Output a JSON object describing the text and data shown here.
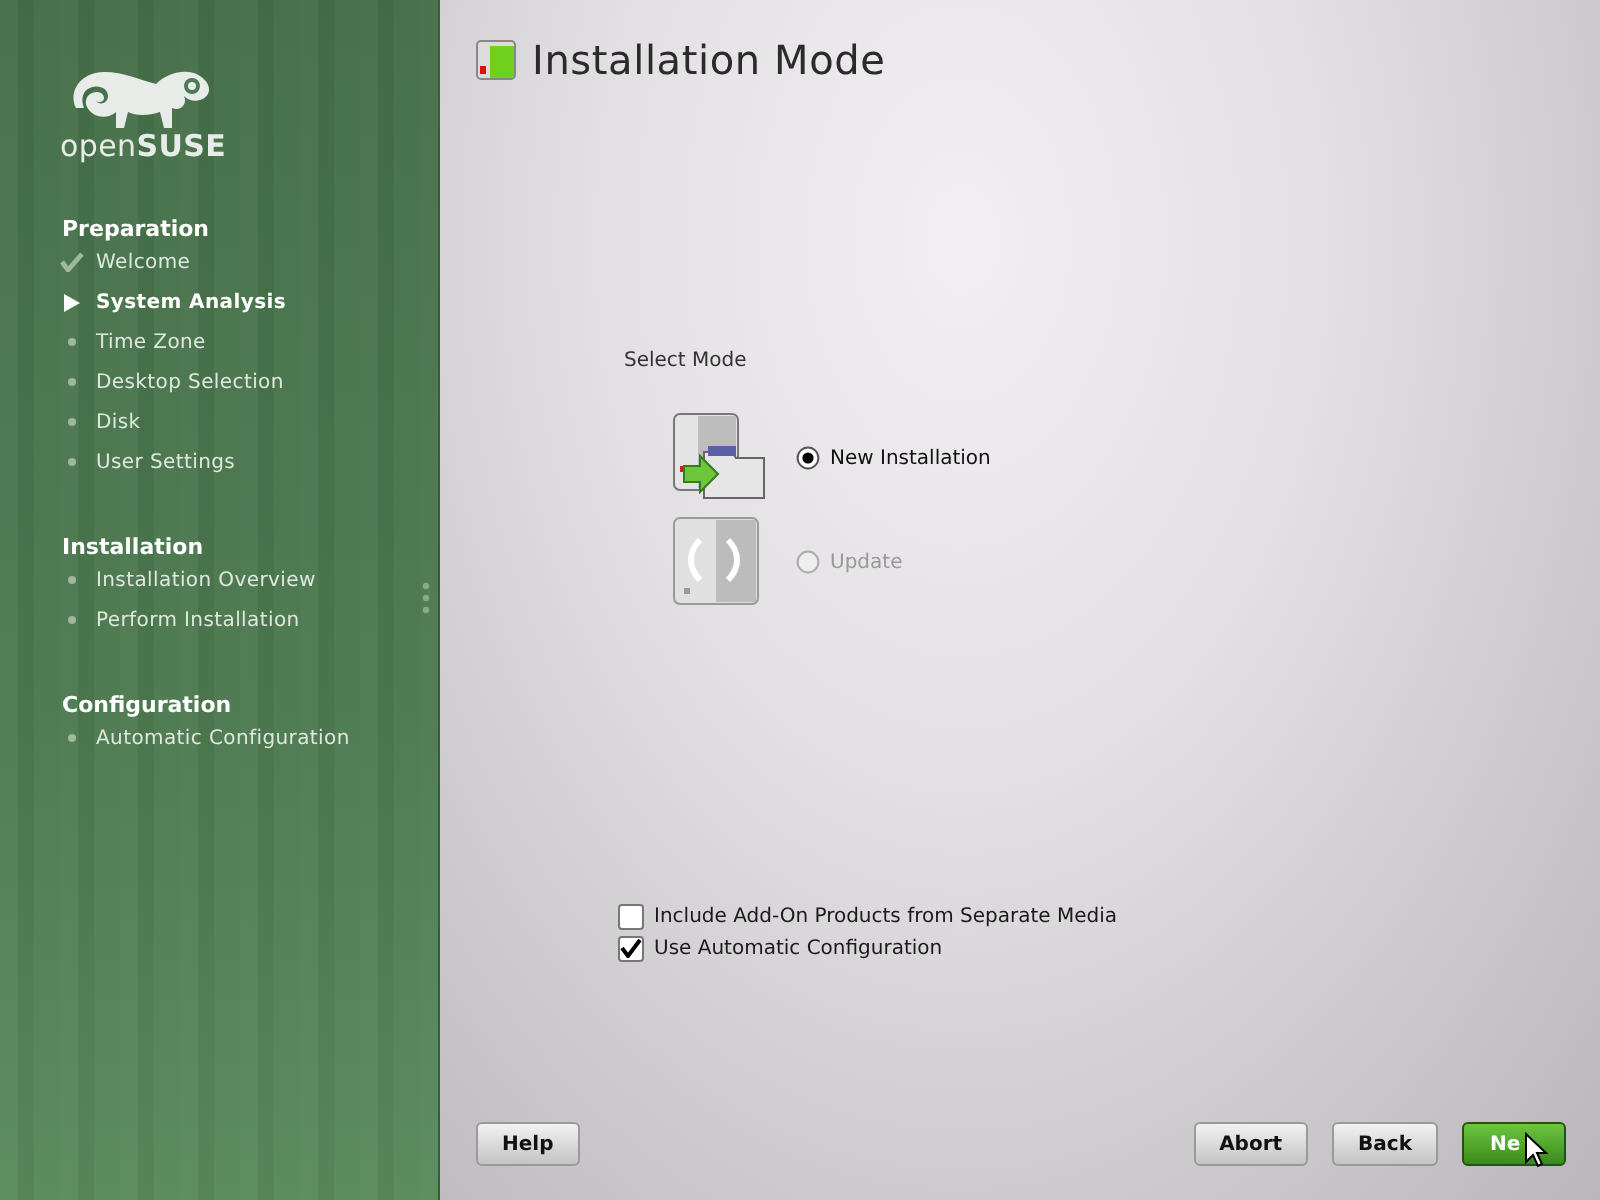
{
  "logo": {
    "text": "open**SUSE**"
  },
  "sidebar": {
    "sections": [
      {
        "title": "Preparation",
        "steps": [
          {
            "label": "Welcome",
            "done": true,
            "selected": false
          },
          {
            "label": "System Analysis",
            "done": false,
            "selected": true
          },
          {
            "label": "Time Zone",
            "done": false,
            "selected": false
          },
          {
            "label": "Desktop Selection",
            "done": false,
            "selected": false
          },
          {
            "label": "Disk",
            "done": false,
            "selected": false
          },
          {
            "label": "User Settings",
            "done": false,
            "selected": false
          }
        ]
      },
      {
        "title": "Installation",
        "steps": [
          {
            "label": "Installation Overview",
            "done": false,
            "selected": false
          },
          {
            "label": "Perform Installation",
            "done": false,
            "selected": false
          }
        ]
      },
      {
        "title": "Configuration",
        "steps": [
          {
            "label": "Automatic Configuration",
            "done": false,
            "selected": false
          }
        ]
      }
    ]
  },
  "window": {
    "title": "Installation Mode"
  },
  "mode": {
    "label": "Select Mode",
    "options": [
      {
        "label": "New Installation",
        "selected": true,
        "disabled": false,
        "kind": "install"
      },
      {
        "label": "Update",
        "selected": false,
        "disabled": true,
        "kind": "update"
      }
    ]
  },
  "checkboxes": [
    {
      "label": "Include Add-On Products from Separate Media",
      "checked": false
    },
    {
      "label": "Use Automatic Configuration",
      "checked": true
    }
  ],
  "buttons": [
    {
      "label": "Help",
      "kind": "normal"
    },
    {
      "label": "Abort",
      "kind": "normal"
    },
    {
      "label": "Back",
      "kind": "normal"
    },
    {
      "label": "Ne",
      "kind": "primary"
    }
  ]
}
